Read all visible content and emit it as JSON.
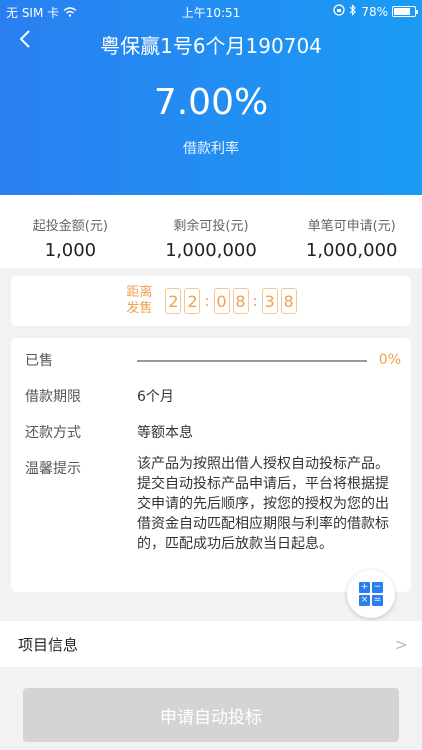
{
  "status": {
    "carrier": "无 SIM 卡",
    "time": "上午10:51",
    "battery": "78%",
    "battery_level": 0.78
  },
  "nav": {
    "title": "粤保赢1号6个月190704"
  },
  "rate": {
    "value": "7.00%",
    "label": "借款利率"
  },
  "stats": [
    {
      "label": "起投金额(元)",
      "value": "1,000"
    },
    {
      "label": "剩余可投(元)",
      "value": "1,000,000"
    },
    {
      "label": "单笔可申请(元)",
      "value": "1,000,000"
    }
  ],
  "countdown": {
    "label_line1": "距离",
    "label_line2": "发售",
    "h1": "2",
    "h2": "2",
    "m1": "0",
    "m2": "8",
    "s1": "3",
    "s2": "8",
    "colon": ":"
  },
  "details": {
    "sold_label": "已售",
    "sold_percent": "0%",
    "sold_fraction": 0,
    "term_label": "借款期限",
    "term_value": "6个月",
    "repay_label": "还款方式",
    "repay_value": "等额本息",
    "notice_label": "温馨提示",
    "notice_text": "该产品为按照出借人授权自动投标产品。提交自动投标产品申请后，平台将根据提交申请的先后顺序，按您的授权为您的出借资金自动匹配相应期限与利率的借款标的，匹配成功后放款当日起息。"
  },
  "calc": {
    "icon": "calculator-icon",
    "k1": "+",
    "k2": "−",
    "k3": "×",
    "k4": "="
  },
  "project": {
    "label": "项目信息",
    "chevron": ">"
  },
  "apply": {
    "label": "申请自动投标"
  },
  "colors": {
    "header_start": "#2a7ff0",
    "header_end": "#1a9bf4",
    "accent_orange": "#f0a050",
    "button_disabled": "#d4d4d6"
  }
}
